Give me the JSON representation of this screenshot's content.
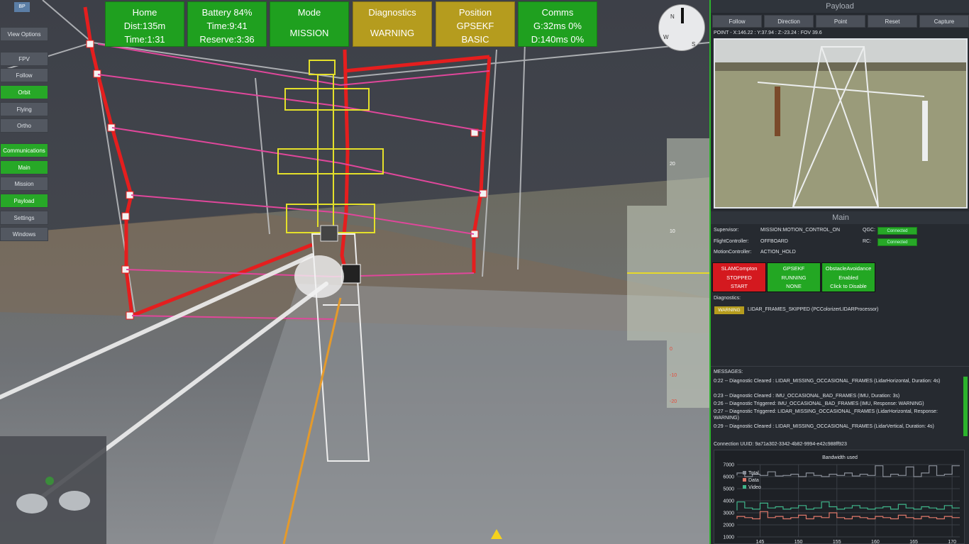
{
  "status_tiles": [
    {
      "title": "Home",
      "line2": "Dist:135m",
      "line3": "Time:1:31",
      "state": "ok"
    },
    {
      "title": "Battery 84%",
      "line2": "Time:9:41",
      "line3": "Reserve:3:36",
      "state": "ok"
    },
    {
      "title": "Mode",
      "line2": "",
      "line3": "MISSION",
      "state": "ok"
    },
    {
      "title": "Diagnostics",
      "line2": "",
      "line3": "WARNING",
      "state": "warn"
    },
    {
      "title": "Position",
      "line2": "GPSEKF",
      "line3": "BASIC",
      "state": "warn"
    },
    {
      "title": "Comms",
      "line2": "G:32ms 0%",
      "line3": "D:140ms 0%",
      "state": "ok"
    }
  ],
  "left_menu": {
    "top_badge": "BP",
    "items": [
      {
        "label": "View Options",
        "state": "normal"
      },
      {
        "label": "FPV",
        "state": "normal"
      },
      {
        "label": "Follow",
        "state": "normal"
      },
      {
        "label": "Orbit",
        "state": "active"
      },
      {
        "label": "Flying",
        "state": "normal"
      },
      {
        "label": "Ortho",
        "state": "normal"
      },
      {
        "label": "Communications",
        "state": "active"
      },
      {
        "label": "Main",
        "state": "active"
      },
      {
        "label": "Mission",
        "state": "normal"
      },
      {
        "label": "Payload",
        "state": "active"
      },
      {
        "label": "Settings",
        "state": "normal"
      },
      {
        "label": "Windows",
        "state": "normal"
      }
    ]
  },
  "compass": {
    "n": "N",
    "w": "W",
    "s": "S"
  },
  "altitude_ticks": [
    "20",
    "10",
    "0",
    "-10",
    "-20"
  ],
  "payload": {
    "title": "Payload",
    "buttons": [
      "Follow",
      "Direction",
      "Point",
      "Reset",
      "Capture"
    ],
    "coords": "POINT - X:146.22 : Y:37.94 : Z:-23.24 : FOV 39.6"
  },
  "main": {
    "title": "Main",
    "supervisor_label": "Supervisor:",
    "supervisor_value": "MISSION:MOTION_CONTROL_ON",
    "flight_label": "FlightController:",
    "flight_value": "OFFBOARD",
    "motion_label": "MotionController:",
    "motion_value": "ACTION_HOLD",
    "qgc_label": "QGC:",
    "qgc_value": "Connected",
    "rc_label": "RC:",
    "rc_value": "Connected",
    "modules": [
      {
        "l1": "SLAMCompton",
        "l2": "STOPPED",
        "l3": "START",
        "color": "red"
      },
      {
        "l1": "GPSEKF",
        "l2": "RUNNING",
        "l3": "NONE",
        "color": "green"
      },
      {
        "l1": "ObstacleAvoidance",
        "l2": "Enabled",
        "l3": "Click to Disable",
        "color": "green"
      }
    ],
    "diagnostics_label": "Diagnostics:",
    "diag_badge": "WARNING",
    "diag_text": "LIDAR_FRAMES_SKIPPED (PCColorizerLIDARProcessor)"
  },
  "messages": {
    "label": "MESSAGES:",
    "items": [
      "0:22 -- Diagnostic Cleared : LIDAR_MISSING_OCCASIONAL_FRAMES (LidarHorizontal, Duration: 4s)",
      "0:23 -- Diagnostic Cleared : IMU_OCCASIONAL_BAD_FRAMES (IMU, Duration: 3s)",
      "0:26 -- Diagnostic Triggered: IMU_OCCASIONAL_BAD_FRAMES (IMU, Response: WARNING)",
      "0:27 -- Diagnostic Triggered: LIDAR_MISSING_OCCASIONAL_FRAMES (LidarHorizontal, Response: WARNING)",
      "0:29 -- Diagnostic Cleared : LIDAR_MISSING_OCCASIONAL_FRAMES (LidarVertical, Duration: 4s)"
    ]
  },
  "connection_uuid": "Connection UUID: 9a71a302-3342-4b82-9994-e42c988ff923",
  "chart_data": {
    "type": "line",
    "title": "Bandwidth used",
    "xlabel": "",
    "ylabel": "",
    "ylim": [
      1000,
      7000
    ],
    "xlim": [
      142,
      171
    ],
    "yticks": [
      1000,
      2000,
      3000,
      4000,
      5000,
      6000,
      7000
    ],
    "xticks": [
      145,
      150,
      155,
      160,
      165,
      170
    ],
    "legend_position": "top-left",
    "x": [
      142,
      143,
      144,
      145,
      146,
      147,
      148,
      149,
      150,
      151,
      152,
      153,
      154,
      155,
      156,
      157,
      158,
      159,
      160,
      161,
      162,
      163,
      164,
      165,
      166,
      167,
      168,
      169,
      170,
      171
    ],
    "series": [
      {
        "name": "Total",
        "color": "#8a8f99",
        "values": [
          6100,
          6300,
          6000,
          6200,
          6100,
          6400,
          6050,
          6100,
          6200,
          6000,
          6300,
          6100,
          6000,
          6200,
          6100,
          6300,
          6050,
          6200,
          6100,
          6900,
          6000,
          6200,
          6100,
          6800,
          6000,
          6300,
          6900,
          6100,
          6200,
          6900
        ]
      },
      {
        "name": "Data",
        "color": "#e0786a",
        "values": [
          2500,
          2700,
          2600,
          2500,
          3100,
          2600,
          2700,
          2500,
          2600,
          2800,
          2500,
          2700,
          2600,
          3000,
          2600,
          2500,
          2700,
          2600,
          2500,
          2700,
          2600,
          2500,
          2800,
          2600,
          2500,
          2700,
          2600,
          2500,
          2700,
          2600
        ]
      },
      {
        "name": "Video",
        "color": "#3fb58a",
        "values": [
          3200,
          3900,
          3400,
          3300,
          3800,
          3400,
          3500,
          3300,
          3400,
          3600,
          3300,
          3400,
          3900,
          3500,
          3300,
          3400,
          3600,
          3400,
          3300,
          3400,
          3500,
          3300,
          3700,
          3400,
          3300,
          3500,
          3400,
          3300,
          3600,
          3400
        ]
      }
    ]
  }
}
